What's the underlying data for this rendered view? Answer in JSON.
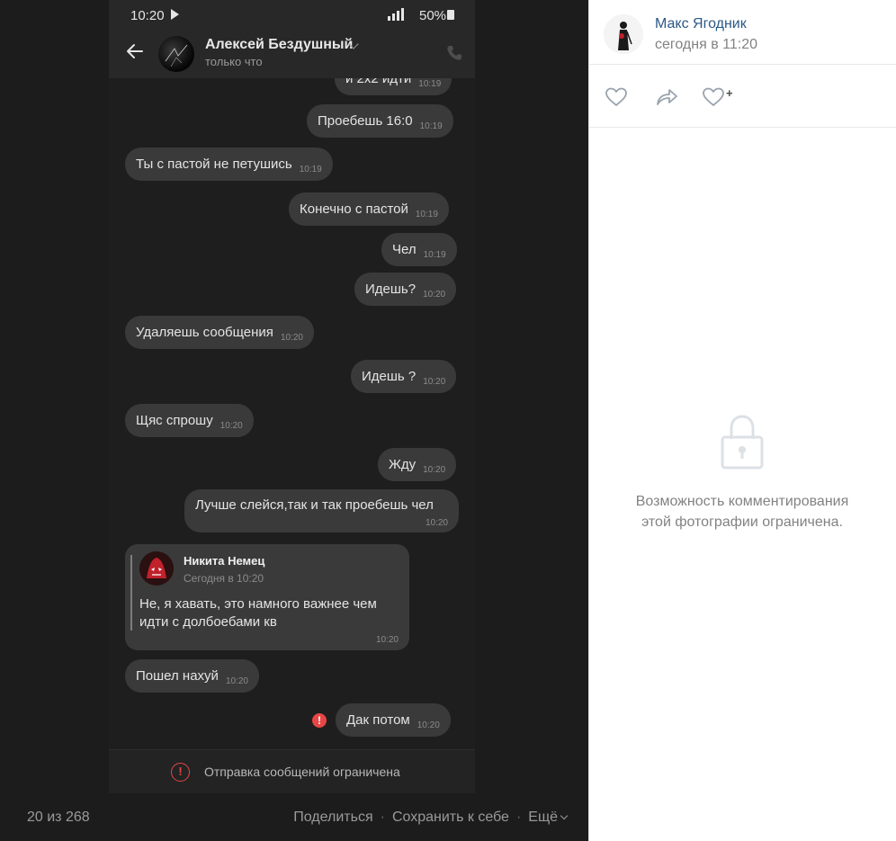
{
  "status_bar": {
    "time": "10:20",
    "battery": "50%"
  },
  "chat_header": {
    "contact_name": "Алексей Бездушный",
    "last_seen": "только что"
  },
  "messages": [
    {
      "text": "и 2х2 идти",
      "time": "10:19",
      "side": "out"
    },
    {
      "text": "Проебешь 16:0",
      "time": "10:19",
      "side": "out"
    },
    {
      "text": "Ты с пастой не петушись",
      "time": "10:19",
      "side": "in"
    },
    {
      "text": "Конечно с пастой",
      "time": "10:19",
      "side": "out"
    },
    {
      "text": "Чел",
      "time": "10:19",
      "side": "out"
    },
    {
      "text": "Идешь?",
      "time": "10:20",
      "side": "out"
    },
    {
      "text": "Удаляешь сообщения",
      "time": "10:20",
      "side": "in"
    },
    {
      "text": "Идешь ?",
      "time": "10:20",
      "side": "out"
    },
    {
      "text": "Щяс спрошу",
      "time": "10:20",
      "side": "in"
    },
    {
      "text": "Жду",
      "time": "10:20",
      "side": "out"
    },
    {
      "text": "Лучше слейся,так и так проебешь чел",
      "time": "10:20",
      "side": "out"
    },
    {
      "text": "Пошел нахуй",
      "time": "10:20",
      "side": "in"
    },
    {
      "text": "Дак потом",
      "time": "10:20",
      "side": "out",
      "failed": true
    }
  ],
  "forwarded": {
    "author": "Никита Немец",
    "date": "Сегодня в 10:20",
    "text": "Не, я хавать, это намного важнее чем идти с долбоебами кв",
    "time": "10:20"
  },
  "restriction": {
    "text": "Отправка сообщений ограничена"
  },
  "viewer_footer": {
    "counter": "20 из 268",
    "share": "Поделиться",
    "save": "Сохранить к себе",
    "more": "Ещё",
    "separator": "·"
  },
  "panel": {
    "author_name": "Макс Ягодник",
    "post_date": "сегодня в 11:20",
    "comments_note_line1": "Возможность комментирования",
    "comments_note_line2": "этой фотографии ограничена.",
    "plus_label": "+"
  },
  "colors": {
    "link_blue": "#2a5885",
    "error_red": "#e64646",
    "bubble": "#3a3a3a",
    "viewer_bg": "#1c1c1c"
  },
  "icons": [
    "back-arrow-icon",
    "phone-icon",
    "chevron-down-icon",
    "error-icon",
    "like-icon",
    "share-icon",
    "add-to-bookmarks-icon",
    "lock-icon"
  ]
}
